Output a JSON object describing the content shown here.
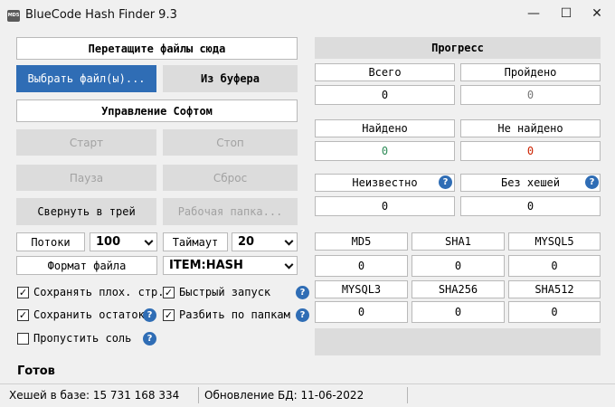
{
  "window": {
    "icon_label": "MD5",
    "title": "BlueCode Hash Finder 9.3",
    "minimize_glyph": "—",
    "maximize_glyph": "☐",
    "close_glyph": "✕"
  },
  "left": {
    "drop_files": "Перетащите файлы сюда",
    "choose_file": "Выбрать файл(ы)...",
    "from_clipboard": "Из буфера",
    "manage_soft": "Управление Софтом",
    "start": "Старт",
    "stop": "Стоп",
    "pause": "Пауза",
    "reset": "Сброс",
    "minimize_tray": "Свернуть в трей",
    "work_folder": "Рабочая папка...",
    "threads_label": "Потоки",
    "threads_value": "100",
    "timeout_label": "Таймаут",
    "timeout_value": "20",
    "file_format_label": "Формат файла",
    "file_format_value": "ITEM:HASH",
    "checkboxes": {
      "save_bad": {
        "label": "Сохранять плох. стр.",
        "checked": true
      },
      "fast_start": {
        "label": "Быстрый запуск",
        "checked": true
      },
      "save_rest": {
        "label": "Сохранить остаток",
        "checked": true
      },
      "split_folders": {
        "label": "Разбить по папкам",
        "checked": true
      },
      "skip_salt": {
        "label": "Пропустить соль",
        "checked": false
      }
    },
    "check_glyph": "✓",
    "help_glyph": "?"
  },
  "progress": {
    "title": "Прогресс",
    "total_label": "Всего",
    "total_value": "0",
    "passed_label": "Пройдено",
    "passed_value": "0",
    "found_label": "Найдено",
    "found_value": "0",
    "not_found_label": "Не найдено",
    "not_found_value": "0",
    "unknown_label": "Неизвестно",
    "unknown_value": "0",
    "no_hashes_label": "Без хешей",
    "no_hashes_value": "0"
  },
  "hash_types": [
    {
      "name": "MD5",
      "value": "0"
    },
    {
      "name": "SHA1",
      "value": "0"
    },
    {
      "name": "MYSQL5",
      "value": "0"
    },
    {
      "name": "MYSQL3",
      "value": "0"
    },
    {
      "name": "SHA256",
      "value": "0"
    },
    {
      "name": "SHA512",
      "value": "0"
    }
  ],
  "status": {
    "state": "Готов",
    "hashes_in_db": "Хешей в базе: 15 731 168 334",
    "db_update": "Обновление БД: 11-06-2022"
  },
  "colors": {
    "accent_blue": "#2f6db5",
    "found_green": "#2e8b57",
    "not_found_red": "#cc2200",
    "passed_gray": "#777777"
  }
}
